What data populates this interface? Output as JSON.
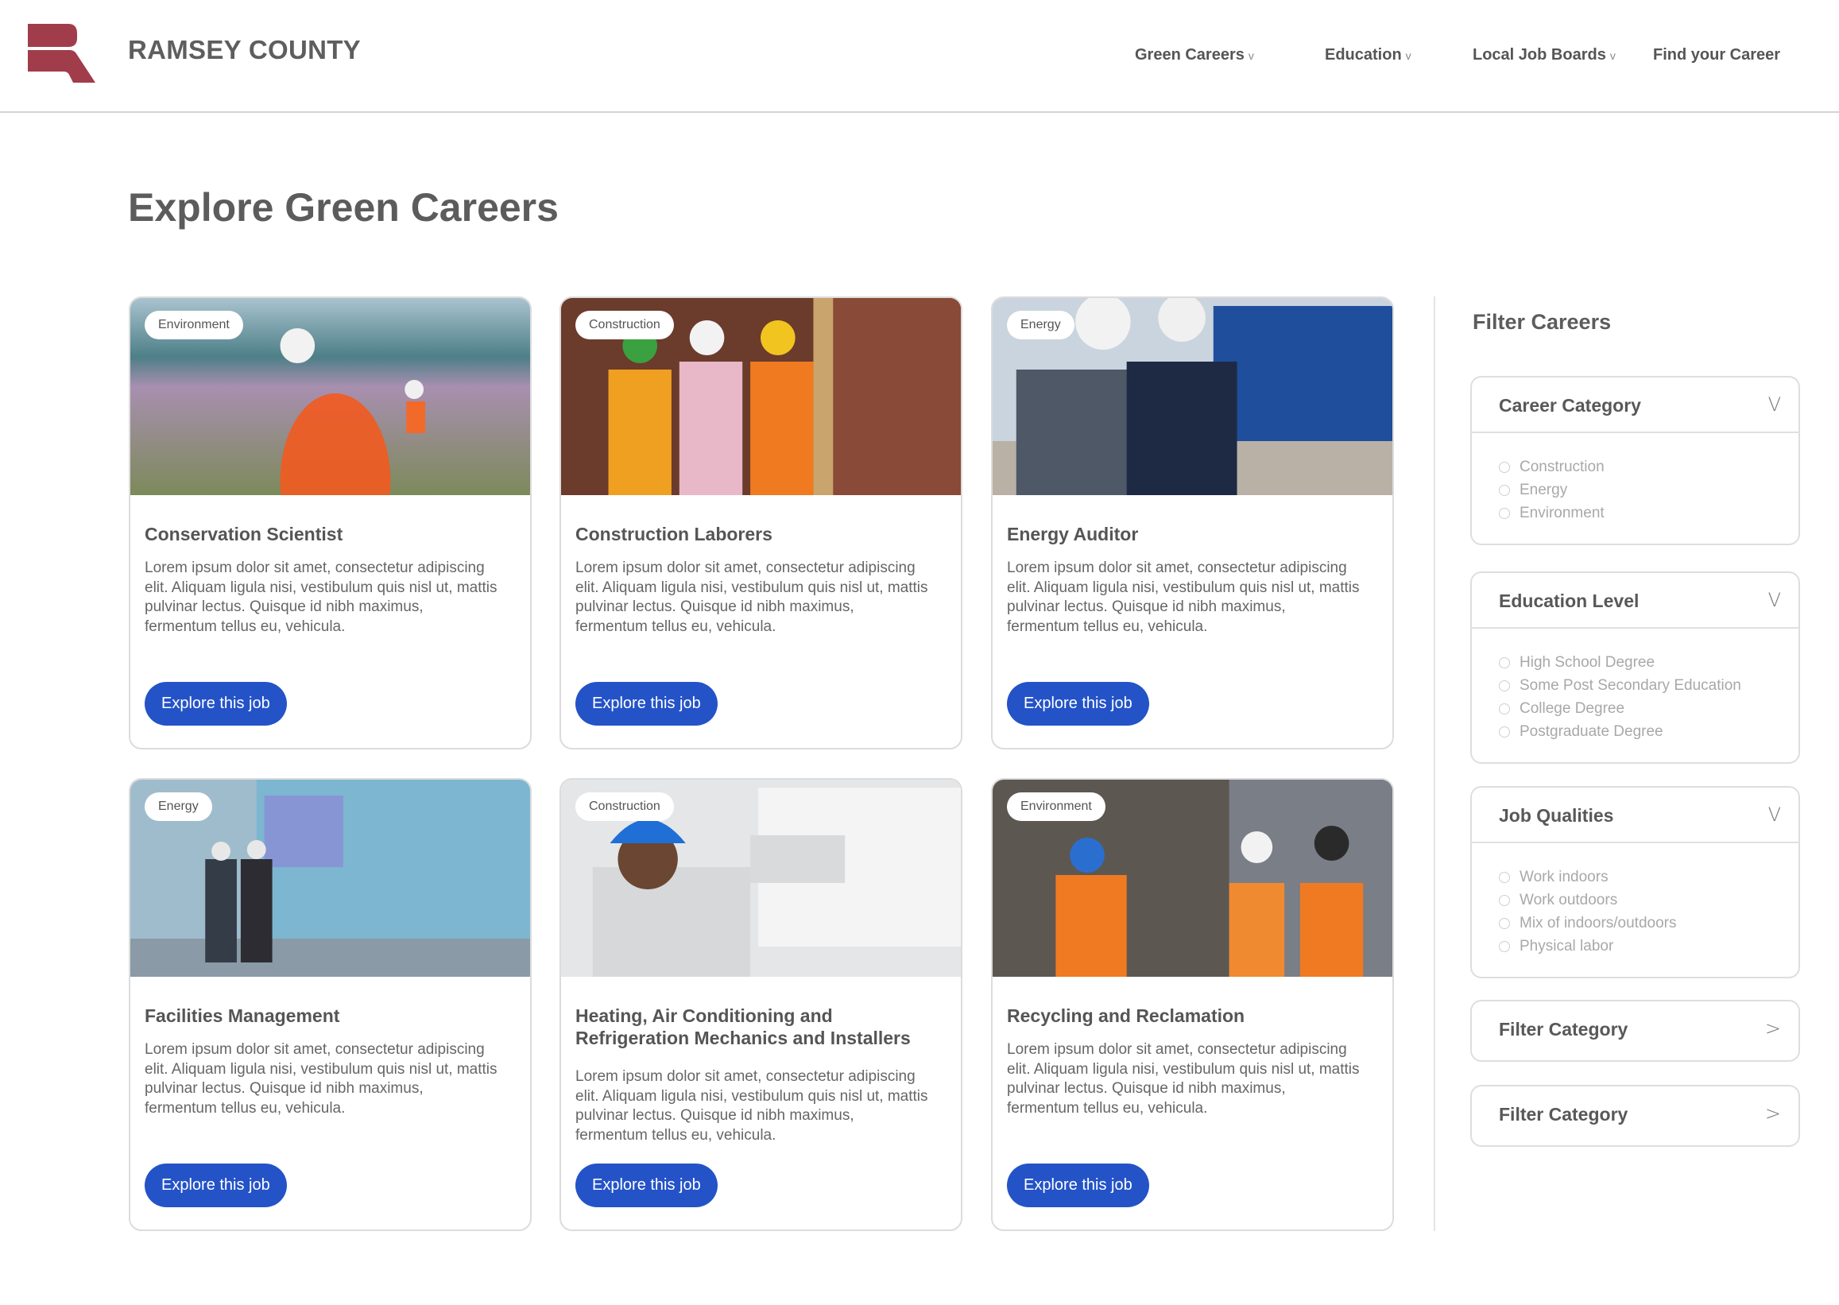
{
  "header": {
    "brand": "RAMSEY COUNTY",
    "brand_color": "#A13C4B",
    "nav": [
      {
        "label": "Green Careers",
        "has_dropdown": true,
        "chevron": "v"
      },
      {
        "label": "Education",
        "has_dropdown": true,
        "chevron": "v"
      },
      {
        "label": "Local Job Boards",
        "has_dropdown": true,
        "chevron": "v"
      },
      {
        "label": "Find your Career",
        "has_dropdown": false,
        "chevron": ""
      }
    ]
  },
  "main": {
    "title": "Explore Green Careers",
    "button_color": "#2453C8",
    "cards": [
      {
        "tag": "Environment",
        "title": "Conservation Scientist",
        "image": "photo-conservation-scientist-field",
        "description": "Lorem ipsum dolor sit amet, consectetur adipiscing elit. Aliquam ligula nisi, vestibulum quis nisl ut, mattis pulvinar lectus. Quisque id nibh maximus, fermentum tellus eu, vehicula.",
        "button": "Explore this job"
      },
      {
        "tag": "Construction",
        "title": "Construction Laborers",
        "image": "photo-construction-workers",
        "description": "Lorem ipsum dolor sit amet, consectetur adipiscing elit. Aliquam ligula nisi, vestibulum quis nisl ut, mattis pulvinar lectus. Quisque id nibh maximus, fermentum tellus eu, vehicula.",
        "button": "Explore this job"
      },
      {
        "tag": "Energy",
        "title": "Energy Auditor",
        "image": "photo-energy-auditors",
        "description": "Lorem ipsum dolor sit amet, consectetur adipiscing elit. Aliquam ligula nisi, vestibulum quis nisl ut, mattis pulvinar lectus. Quisque id nibh maximus, fermentum tellus eu, vehicula.",
        "button": "Explore this job"
      },
      {
        "tag": "Energy",
        "title": "Facilities Management",
        "image": "photo-facilities-management",
        "description": "Lorem ipsum dolor sit amet, consectetur adipiscing elit. Aliquam ligula nisi, vestibulum quis nisl ut, mattis pulvinar lectus. Quisque id nibh maximus, fermentum tellus eu, vehicula.",
        "button": "Explore this job"
      },
      {
        "tag": "Construction",
        "title": "Heating, Air Conditioning and Refrigeration Mechanics and Installers",
        "image": "photo-hvac-technician",
        "description": "Lorem ipsum dolor sit amet, consectetur adipiscing elit. Aliquam ligula nisi, vestibulum quis nisl ut, mattis pulvinar lectus. Quisque id nibh maximus, fermentum tellus eu, vehicula.",
        "button": "Explore this job"
      },
      {
        "tag": "Environment",
        "title": "Recycling and Reclamation",
        "image": "photo-recycling-workers",
        "description": "Lorem ipsum dolor sit amet, consectetur adipiscing elit. Aliquam ligula nisi, vestibulum quis nisl ut, mattis pulvinar lectus. Quisque id nibh maximus, fermentum tellus eu, vehicula.",
        "button": "Explore this job"
      }
    ]
  },
  "filters": {
    "title": "Filter Careers",
    "groups": [
      {
        "label": "Career Category",
        "chevron": "V",
        "expanded": true,
        "options": [
          "Construction",
          "Energy",
          "Environment"
        ]
      },
      {
        "label": "Education Level",
        "chevron": "V",
        "expanded": true,
        "options": [
          "High School Degree",
          "Some Post Secondary Education",
          "College Degree",
          "Postgraduate Degree"
        ]
      },
      {
        "label": "Job Qualities",
        "chevron": "V",
        "expanded": true,
        "options": [
          "Work indoors",
          "Work outdoors",
          "Mix of indoors/outdoors",
          "Physical labor"
        ]
      },
      {
        "label": "Filter Category",
        "chevron": ">",
        "expanded": false,
        "options": []
      },
      {
        "label": "Filter Category",
        "chevron": ">",
        "expanded": false,
        "options": []
      }
    ]
  }
}
